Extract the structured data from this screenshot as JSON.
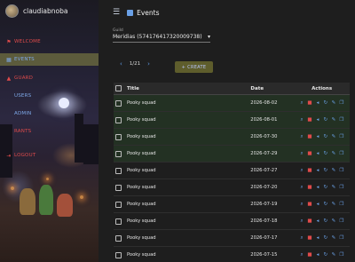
{
  "profile": {
    "username": "claudiabnoba"
  },
  "sidebar": {
    "items": [
      {
        "label": "WELCOME",
        "icon": "flag-icon"
      },
      {
        "label": "EVENTS",
        "icon": "calendar-icon",
        "active": true
      },
      {
        "label": "GUARD",
        "icon": "shield-icon"
      },
      {
        "label": "USERS",
        "icon": "users-icon"
      },
      {
        "label": "ADMIN",
        "icon": "admin-icon"
      },
      {
        "label": "RANTS",
        "icon": "chat-icon"
      },
      {
        "label": "LOGOUT",
        "icon": "logout-icon"
      }
    ]
  },
  "header": {
    "title": "Events",
    "menu_icon": "hamburger-icon"
  },
  "guild": {
    "label": "Guild",
    "value": "Meridias (574176417320009738)"
  },
  "pager": {
    "current": "1/21"
  },
  "create_button": {
    "label": "CREATE",
    "icon": "plus-icon"
  },
  "table": {
    "columns": [
      "Title",
      "Date",
      "Actions"
    ],
    "rows": [
      {
        "title": "Pooky squad",
        "date": "2026-08-02"
      },
      {
        "title": "Pooky squad",
        "date": "2026-08-01"
      },
      {
        "title": "Pooky squad",
        "date": "2026-07-30"
      },
      {
        "title": "Pooky squad",
        "date": "2026-07-29"
      },
      {
        "title": "Pooky squad",
        "date": "2026-07-27"
      },
      {
        "title": "Pooky squad",
        "date": "2026-07-20"
      },
      {
        "title": "Pooky squad",
        "date": "2026-07-19"
      },
      {
        "title": "Pooky squad",
        "date": "2026-07-18"
      },
      {
        "title": "Pooky squad",
        "date": "2026-07-17"
      },
      {
        "title": "Pooky squad",
        "date": "2026-07-15"
      }
    ],
    "actions": [
      "search-icon",
      "delete-icon",
      "announce-icon",
      "refresh-icon",
      "edit-icon",
      "copy-icon"
    ]
  },
  "colors": {
    "accent": "#6aa0e6",
    "danger": "#e04b4b",
    "active_nav": "#8c8c46",
    "create_bg": "#5e5d2c"
  }
}
